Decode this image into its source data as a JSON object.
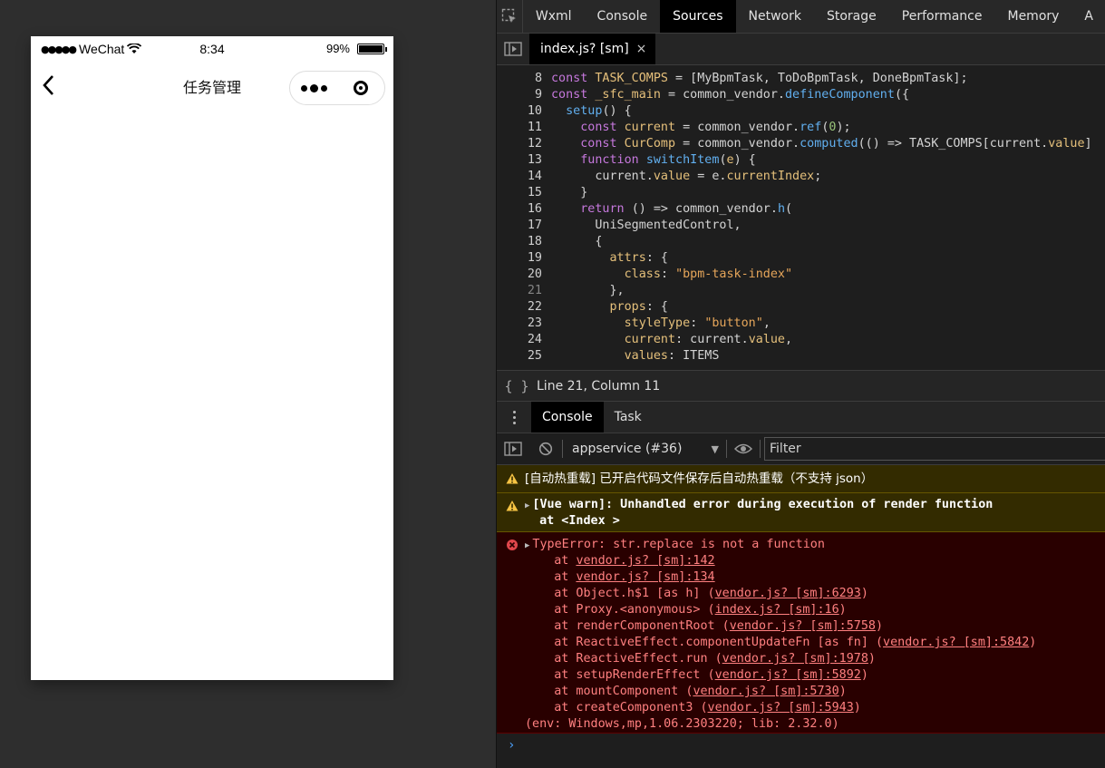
{
  "simulator": {
    "status_bar": {
      "carrier_dots": "●●●●●",
      "carrier": "WeChat",
      "time": "8:34",
      "battery": "99%",
      "battery_level": 0.99
    },
    "nav": {
      "title": "任务管理"
    }
  },
  "devtools": {
    "tabs": [
      "Wxml",
      "Console",
      "Sources",
      "Network",
      "Storage",
      "Performance",
      "Memory",
      "A"
    ],
    "active_tab": "Sources",
    "file_tab": {
      "name": "index.js? [sm]",
      "close": "×"
    },
    "code": [
      {
        "ln": "8",
        "tokens": [
          [
            "kw",
            "const "
          ],
          [
            "id",
            "TASK_COMPS"
          ],
          [
            "pl",
            " = [MyBpmTask, ToDoBpmTask, DoneBpmTask];"
          ]
        ]
      },
      {
        "ln": "9",
        "tokens": [
          [
            "kw",
            "const "
          ],
          [
            "id",
            "_sfc_main"
          ],
          [
            "pl",
            " = common_vendor."
          ],
          [
            "fn",
            "defineComponent"
          ],
          [
            "pl",
            "({"
          ]
        ]
      },
      {
        "ln": "10",
        "tokens": [
          [
            "pl",
            "  "
          ],
          [
            "fn",
            "setup"
          ],
          [
            "pl",
            "() {"
          ]
        ]
      },
      {
        "ln": "11",
        "tokens": [
          [
            "pl",
            "    "
          ],
          [
            "kw",
            "const "
          ],
          [
            "id",
            "current"
          ],
          [
            "pl",
            " = common_vendor."
          ],
          [
            "fn",
            "ref"
          ],
          [
            "pl",
            "("
          ],
          [
            "num",
            "0"
          ],
          [
            "pl",
            ");"
          ]
        ]
      },
      {
        "ln": "12",
        "tokens": [
          [
            "pl",
            "    "
          ],
          [
            "kw",
            "const "
          ],
          [
            "id",
            "CurComp"
          ],
          [
            "pl",
            " = common_vendor."
          ],
          [
            "fn",
            "computed"
          ],
          [
            "pl",
            "(() => TASK_COMPS[current."
          ],
          [
            "prop",
            "value"
          ],
          [
            "pl",
            "]"
          ]
        ]
      },
      {
        "ln": "13",
        "tokens": [
          [
            "pl",
            "    "
          ],
          [
            "kw",
            "function "
          ],
          [
            "fn",
            "switchItem"
          ],
          [
            "pl",
            "("
          ],
          [
            "prop",
            "e"
          ],
          [
            "pl",
            ") {"
          ]
        ]
      },
      {
        "ln": "14",
        "tokens": [
          [
            "pl",
            "      current."
          ],
          [
            "prop",
            "value"
          ],
          [
            "pl",
            " = e."
          ],
          [
            "prop",
            "currentIndex"
          ],
          [
            "pl",
            ";"
          ]
        ]
      },
      {
        "ln": "15",
        "tokens": [
          [
            "pl",
            "    }"
          ]
        ]
      },
      {
        "ln": "16",
        "tokens": [
          [
            "pl",
            "    "
          ],
          [
            "kw",
            "return "
          ],
          [
            "pl",
            "() => common_vendor."
          ],
          [
            "fn",
            "h"
          ],
          [
            "pl",
            "("
          ]
        ]
      },
      {
        "ln": "17",
        "tokens": [
          [
            "pl",
            "      UniSegmentedControl,"
          ]
        ]
      },
      {
        "ln": "18",
        "tokens": [
          [
            "pl",
            "      {"
          ]
        ]
      },
      {
        "ln": "19",
        "tokens": [
          [
            "pl",
            "        "
          ],
          [
            "prop",
            "attrs"
          ],
          [
            "pl",
            ": {"
          ]
        ]
      },
      {
        "ln": "20",
        "tokens": [
          [
            "pl",
            "          "
          ],
          [
            "prop",
            "class"
          ],
          [
            "pl",
            ": "
          ],
          [
            "str",
            "\"bpm-task-index\""
          ]
        ]
      },
      {
        "ln": "21",
        "dim": true,
        "tokens": [
          [
            "pl",
            "        },"
          ]
        ]
      },
      {
        "ln": "22",
        "tokens": [
          [
            "pl",
            "        "
          ],
          [
            "prop",
            "props"
          ],
          [
            "pl",
            ": {"
          ]
        ]
      },
      {
        "ln": "23",
        "tokens": [
          [
            "pl",
            "          "
          ],
          [
            "prop",
            "styleType"
          ],
          [
            "pl",
            ": "
          ],
          [
            "str",
            "\"button\""
          ],
          [
            "pl",
            ","
          ]
        ]
      },
      {
        "ln": "24",
        "tokens": [
          [
            "pl",
            "          "
          ],
          [
            "prop",
            "current"
          ],
          [
            "pl",
            ": current."
          ],
          [
            "prop",
            "value"
          ],
          [
            "pl",
            ","
          ]
        ]
      },
      {
        "ln": "25",
        "tokens": [
          [
            "pl",
            "          "
          ],
          [
            "prop",
            "values"
          ],
          [
            "pl",
            ": ITEMS"
          ]
        ]
      }
    ],
    "cursor_status": "Line 21, Column 11",
    "console_tabs": [
      "Console",
      "Task"
    ],
    "active_console_tab": "Console",
    "context": "appservice (#36)",
    "filter_placeholder": "Filter",
    "messages": {
      "hot_reload": "[自动热重载] 已开启代码文件保存后自动热重载（不支持 json）",
      "vue_warn": [
        "[Vue warn]: Unhandled error during execution of render function",
        "  at <Index >"
      ],
      "error_title": "TypeError: str.replace is not a function",
      "stack": [
        {
          "pre": "    at ",
          "link": "vendor.js? [sm]:142",
          "post": ""
        },
        {
          "pre": "    at ",
          "link": "vendor.js? [sm]:134",
          "post": ""
        },
        {
          "pre": "    at Object.h$1 [as h] (",
          "link": "vendor.js? [sm]:6293",
          "post": ")"
        },
        {
          "pre": "    at Proxy.<anonymous> (",
          "link": "index.js? [sm]:16",
          "post": ")"
        },
        {
          "pre": "    at renderComponentRoot (",
          "link": "vendor.js? [sm]:5758",
          "post": ")"
        },
        {
          "pre": "    at ReactiveEffect.componentUpdateFn [as fn] (",
          "link": "vendor.js? [sm]:5842",
          "post": ")"
        },
        {
          "pre": "    at ReactiveEffect.run (",
          "link": "vendor.js? [sm]:1978",
          "post": ")"
        },
        {
          "pre": "    at setupRenderEffect (",
          "link": "vendor.js? [sm]:5892",
          "post": ")"
        },
        {
          "pre": "    at mountComponent (",
          "link": "vendor.js? [sm]:5730",
          "post": ")"
        },
        {
          "pre": "    at createComponent3 (",
          "link": "vendor.js? [sm]:5943",
          "post": ")"
        }
      ],
      "env": "(env: Windows,mp,1.06.2303220; lib: 2.32.0)"
    },
    "prompt": "›"
  }
}
